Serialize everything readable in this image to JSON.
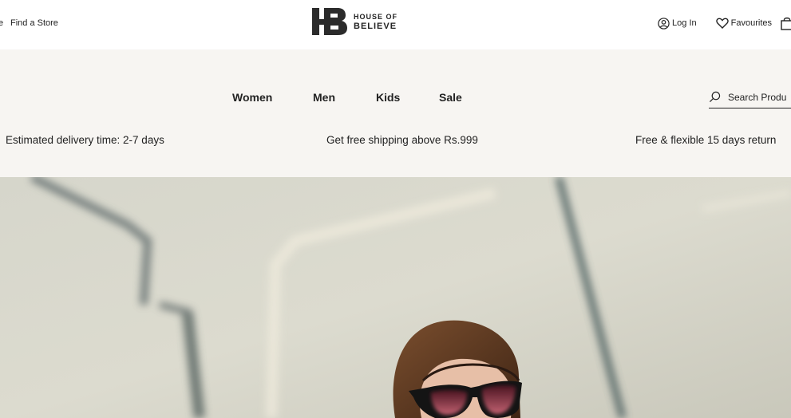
{
  "topbar": {
    "left_cut_text": "e",
    "find_store": "Find a Store",
    "login": "Log In",
    "favourites": "Favourites"
  },
  "logo": {
    "line1": "HOUSE OF",
    "line2": "BELIEVE"
  },
  "nav": {
    "items": [
      "Women",
      "Men",
      "Kids",
      "Sale"
    ]
  },
  "search": {
    "placeholder": "Search Produ"
  },
  "perks": [
    "Estimated delivery time: 2-7 days",
    "Get free shipping above Rs.999",
    "Free & flexible 15 days return"
  ],
  "icons": {
    "login": "person-circle-icon",
    "favourites": "heart-icon",
    "bag": "shopping-bag-icon",
    "search": "search-icon"
  },
  "colors": {
    "nav_bg": "#f7f5f2",
    "hero_bg": "#d9d8cc"
  }
}
